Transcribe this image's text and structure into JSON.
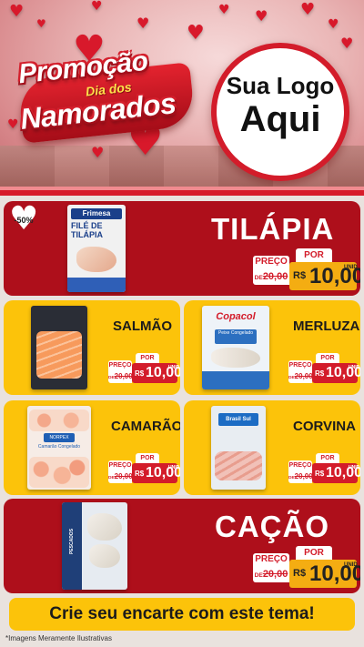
{
  "header": {
    "title_line1": "Promoção",
    "title_line2": "Dia dos",
    "title_line3": "Namorados",
    "logo_line1": "Sua Logo",
    "logo_line2": "Aqui"
  },
  "colors": {
    "red": "#ae0f1b",
    "yellow": "#fcc30a",
    "price_red": "#d31c2a",
    "price_gold": "#f4ad12"
  },
  "price_labels": {
    "preco": "PREÇO",
    "por": "POR",
    "de": "DE",
    "rs": "R$",
    "unid": "UNID"
  },
  "featured": [
    {
      "name": "TILÁPIA",
      "discount": "-50%",
      "brand": "Frimesa",
      "package_text": "FILÉ DE TILÁPIA",
      "old_price": "20,00",
      "new_price": "10,00"
    },
    {
      "name": "CAÇÃO",
      "package_text": "PESCADOS",
      "old_price": "20,00",
      "new_price": "10,00"
    }
  ],
  "products": [
    {
      "name": "SALMÃO",
      "old_price": "20,00",
      "new_price": "10,00"
    },
    {
      "name": "MERLUZA",
      "brand": "Copacol",
      "package_text": "Peixe Congelado",
      "old_price": "20,00",
      "new_price": "10,00"
    },
    {
      "name": "CAMARÃO",
      "brand": "NORPEX",
      "package_text": "Camarão Congelado",
      "old_price": "20,00",
      "new_price": "10,00"
    },
    {
      "name": "CORVINA",
      "brand": "Brasil Sul",
      "old_price": "20,00",
      "new_price": "10,00"
    }
  ],
  "footer": {
    "cta": "Crie seu encarte com este tema!",
    "disclaimer": "*Imagens Meramente Ilustrativas"
  }
}
